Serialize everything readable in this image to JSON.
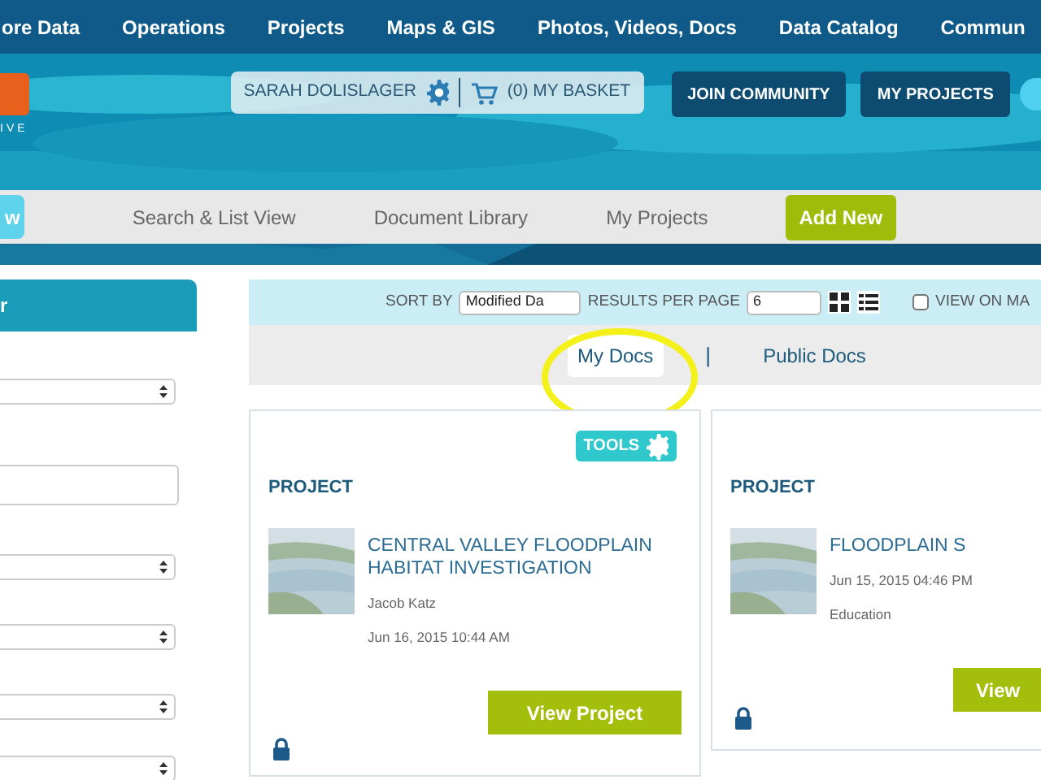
{
  "top_nav": {
    "items": [
      "ore Data",
      "Operations",
      "Projects",
      "Maps & GIS",
      "Photos, Videos, Docs",
      "Data Catalog",
      "Commun"
    ]
  },
  "header": {
    "logo_text": "IVE",
    "user": "SARAH DOLISLAGER",
    "basket": "(0) MY BASKET",
    "buttons": [
      "JOIN COMMUNITY",
      "MY PROJECTS"
    ]
  },
  "sub_nav": {
    "items": [
      {
        "label": "w",
        "kind": "cyan"
      },
      {
        "label": "Search & List View",
        "kind": "link"
      },
      {
        "label": "Document Library",
        "kind": "link"
      },
      {
        "label": "My Projects",
        "kind": "link"
      },
      {
        "label": "Add New",
        "kind": "green"
      }
    ]
  },
  "sidebar": {
    "title": "r",
    "fields": [
      {
        "kind": "select"
      },
      {
        "kind": "input"
      },
      {
        "kind": "select"
      },
      {
        "kind": "select"
      },
      {
        "kind": "select"
      },
      {
        "kind": "select"
      }
    ]
  },
  "toolbar": {
    "sort_label": "SORT BY",
    "sort_value": "Modified Da",
    "per_page_label": "RESULTS PER PAGE",
    "per_page_value": "6",
    "view_on_map": {
      "label": "VIEW ON MA",
      "checked": false
    }
  },
  "doc_tabs": [
    {
      "label": "My Docs",
      "selected": true
    },
    {
      "label": "Public Docs",
      "selected": false
    }
  ],
  "tab_separator": "|",
  "cards": [
    {
      "tools": "TOOLS",
      "type": "PROJECT",
      "title": "CENTRAL VALLEY FLOODPLAIN HABITAT INVESTIGATION",
      "lines": [
        "Jacob Katz",
        "Jun 16, 2015 10:44 AM"
      ],
      "button": "View Project",
      "locked": true
    },
    {
      "type": "PROJECT",
      "title": "FLOODPLAIN S",
      "lines": [
        "Jun 15, 2015 04:46 PM",
        "Education"
      ],
      "button": "View",
      "locked": true
    }
  ]
}
